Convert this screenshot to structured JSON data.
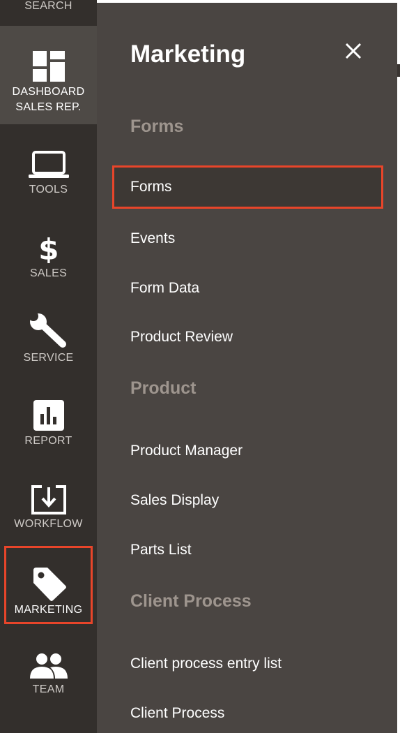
{
  "rail": {
    "search": "SEARCH",
    "dashboard": [
      "DASHBOARD",
      "SALES REP."
    ],
    "tools": "TOOLS",
    "sales": "SALES",
    "service": "SERVICE",
    "report": "REPORT",
    "workflow": "WORKFLOW",
    "marketing": "MARKETING",
    "team": "TEAM"
  },
  "drawer": {
    "title": "Marketing",
    "sections": [
      {
        "heading": "Forms",
        "items": [
          "Forms",
          "Events",
          "Form Data",
          "Product Review"
        ]
      },
      {
        "heading": "Product",
        "items": [
          "Product Manager",
          "Sales Display",
          "Parts List"
        ]
      },
      {
        "heading": "Client Process",
        "items": [
          "Client process entry list",
          "Client Process"
        ]
      }
    ]
  },
  "colors": {
    "rail_bg": "#332f2c",
    "rail_active_bg": "#4e4a46",
    "drawer_bg": "#4a4542",
    "highlight": "#e8452a",
    "section_heading": "#9e958e"
  }
}
